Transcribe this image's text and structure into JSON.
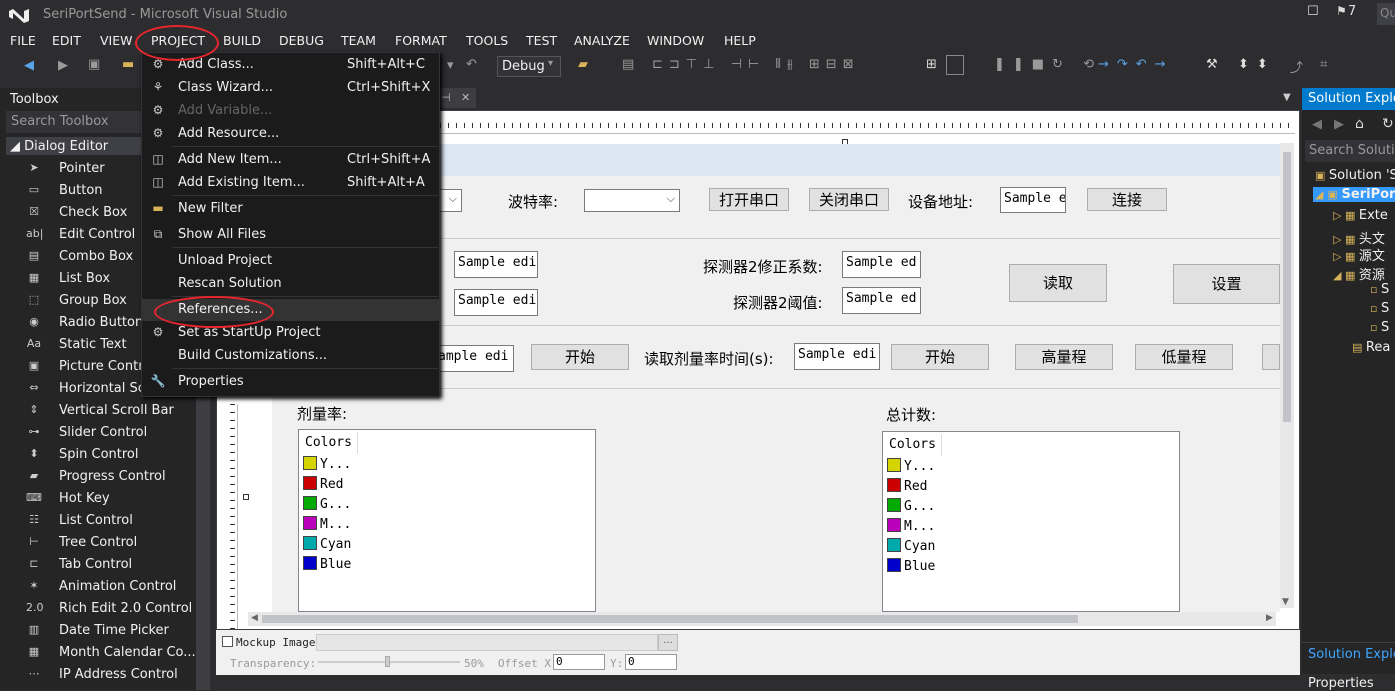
{
  "window": {
    "title": "SeriPortSend - Microsoft Visual Studio",
    "notifications": "7",
    "quick_launch": "Qu"
  },
  "menubar": {
    "items": [
      "FILE",
      "EDIT",
      "VIEW",
      "PROJECT",
      "BUILD",
      "DEBUG",
      "TEAM",
      "FORMAT",
      "TOOLS",
      "TEST",
      "ANALYZE",
      "WINDOW",
      "HELP"
    ]
  },
  "toolbar": {
    "config": "Debug"
  },
  "toolbox": {
    "title": "Toolbox",
    "search_placeholder": "Search Toolbox",
    "group": "Dialog Editor",
    "items": [
      {
        "label": "Pointer",
        "icon": "pointer-icon"
      },
      {
        "label": "Button",
        "icon": "button-icon"
      },
      {
        "label": "Check Box",
        "icon": "checkbox-icon"
      },
      {
        "label": "Edit Control",
        "icon": "edit-icon"
      },
      {
        "label": "Combo Box",
        "icon": "combobox-icon"
      },
      {
        "label": "List Box",
        "icon": "listbox-icon"
      },
      {
        "label": "Group Box",
        "icon": "groupbox-icon"
      },
      {
        "label": "Radio Button",
        "icon": "radio-icon"
      },
      {
        "label": "Static Text",
        "icon": "static-text-icon"
      },
      {
        "label": "Picture Control",
        "icon": "picture-icon"
      },
      {
        "label": "Horizontal Scroll Bar",
        "icon": "hscroll-icon"
      },
      {
        "label": "Vertical Scroll Bar",
        "icon": "vscroll-icon"
      },
      {
        "label": "Slider Control",
        "icon": "slider-icon"
      },
      {
        "label": "Spin Control",
        "icon": "spin-icon"
      },
      {
        "label": "Progress Control",
        "icon": "progress-icon"
      },
      {
        "label": "Hot Key",
        "icon": "hotkey-icon"
      },
      {
        "label": "List Control",
        "icon": "listcontrol-icon"
      },
      {
        "label": "Tree Control",
        "icon": "tree-icon"
      },
      {
        "label": "Tab Control",
        "icon": "tab-icon"
      },
      {
        "label": "Animation Control",
        "icon": "animation-icon"
      },
      {
        "label": "Rich Edit 2.0 Control",
        "icon": "richedit-icon"
      },
      {
        "label": "Date Time Picker",
        "icon": "datetime-icon"
      },
      {
        "label": "Month Calendar Co...",
        "icon": "calendar-icon"
      },
      {
        "label": "IP Address Control",
        "icon": "ip-icon"
      }
    ]
  },
  "project_menu": {
    "items": [
      {
        "label": "Add Class...",
        "shortcut": "Shift+Alt+C",
        "icon": "add-class-icon",
        "disabled": false
      },
      {
        "label": "Class Wizard...",
        "shortcut": "Ctrl+Shift+X",
        "icon": "class-wizard-icon",
        "disabled": false
      },
      {
        "label": "Add Variable...",
        "shortcut": "",
        "icon": "add-variable-icon",
        "disabled": true
      },
      {
        "label": "Add Resource...",
        "shortcut": "",
        "icon": "add-resource-icon",
        "disabled": false
      },
      {
        "label": "Add New Item...",
        "shortcut": "Ctrl+Shift+A",
        "icon": "add-new-item-icon",
        "disabled": false
      },
      {
        "label": "Add Existing Item...",
        "shortcut": "Shift+Alt+A",
        "icon": "add-existing-item-icon",
        "disabled": false
      },
      {
        "label": "New Filter",
        "shortcut": "",
        "icon": "folder-icon",
        "disabled": false
      },
      {
        "label": "Show All Files",
        "shortcut": "",
        "icon": "show-all-files-icon",
        "disabled": false
      },
      {
        "label": "Unload Project",
        "shortcut": "",
        "icon": "",
        "disabled": false
      },
      {
        "label": "Rescan Solution",
        "shortcut": "",
        "icon": "",
        "disabled": false
      },
      {
        "label": "References...",
        "shortcut": "",
        "icon": "",
        "disabled": false
      },
      {
        "label": "Set as StartUp Project",
        "shortcut": "",
        "icon": "gear-icon",
        "disabled": false
      },
      {
        "label": "Build Customizations...",
        "shortcut": "",
        "icon": "",
        "disabled": false
      },
      {
        "label": "Properties",
        "shortcut": "",
        "icon": "wrench-icon",
        "disabled": false
      }
    ]
  },
  "dialog": {
    "baud_label": "波特率:",
    "open_port": "打开串口",
    "close_port": "关闭串口",
    "device_addr_label": "设备地址:",
    "device_addr_value": "Sample e",
    "connect": "连接",
    "edit1": "Sample edi",
    "edit2": "Sample edi",
    "det2_coef_label": "探测器2修正系数:",
    "det2_coef_value": "Sample ed",
    "det2_thresh_label": "探测器2阈值:",
    "det2_thresh_value": "Sample ed",
    "read": "读取",
    "set": "设置",
    "edit3": "ample edi",
    "start1": "开始",
    "read_dose_time_label": "读取剂量率时间(s):",
    "read_dose_time_value": "Sample edi",
    "start2": "开始",
    "high_range": "高量程",
    "low_range": "低量程",
    "dose_rate_label": "剂量率:",
    "total_count_label": "总计数:",
    "listbox_header": "Colors",
    "listbox1_items": [
      {
        "label": "Y...",
        "color": "#d4d400"
      },
      {
        "label": "Red",
        "color": "#cc0000"
      },
      {
        "label": "G...",
        "color": "#00aa00"
      },
      {
        "label": "M...",
        "color": "#bb00bb"
      },
      {
        "label": "Cyan",
        "color": "#00aaaa"
      },
      {
        "label": "Blue",
        "color": "#0000cc"
      }
    ],
    "listbox2_items": [
      {
        "label": "Y...",
        "color": "#d4d400"
      },
      {
        "label": "Red",
        "color": "#cc0000"
      },
      {
        "label": "G...",
        "color": "#00aa00"
      },
      {
        "label": "M...",
        "color": "#bb00bb"
      },
      {
        "label": "Cyan",
        "color": "#00aaaa"
      },
      {
        "label": "Blue",
        "color": "#0000cc"
      }
    ]
  },
  "mockup": {
    "checkbox_label": "Mockup Image:",
    "transparency_label": "Transparency:",
    "transparency_value": "50%",
    "offset_x_label": "Offset X:",
    "offset_x_value": "0",
    "y_label": "Y:",
    "y_value": "0"
  },
  "solution_explorer": {
    "title": "Solution Explorer",
    "search_placeholder": "Search Solution",
    "items": [
      {
        "label": "Solution 'S"
      },
      {
        "label": "SeriPor"
      },
      {
        "label": "Exte"
      },
      {
        "label": "头文"
      },
      {
        "label": "源文"
      },
      {
        "label": "资源"
      },
      {
        "label": "S"
      },
      {
        "label": "S"
      },
      {
        "label": "S"
      },
      {
        "label": "Rea"
      }
    ],
    "footer_title": "Solution Explor",
    "properties_title": "Properties"
  },
  "colors": {
    "accent": "#007acc",
    "highlight_ring": "#e8262c"
  }
}
